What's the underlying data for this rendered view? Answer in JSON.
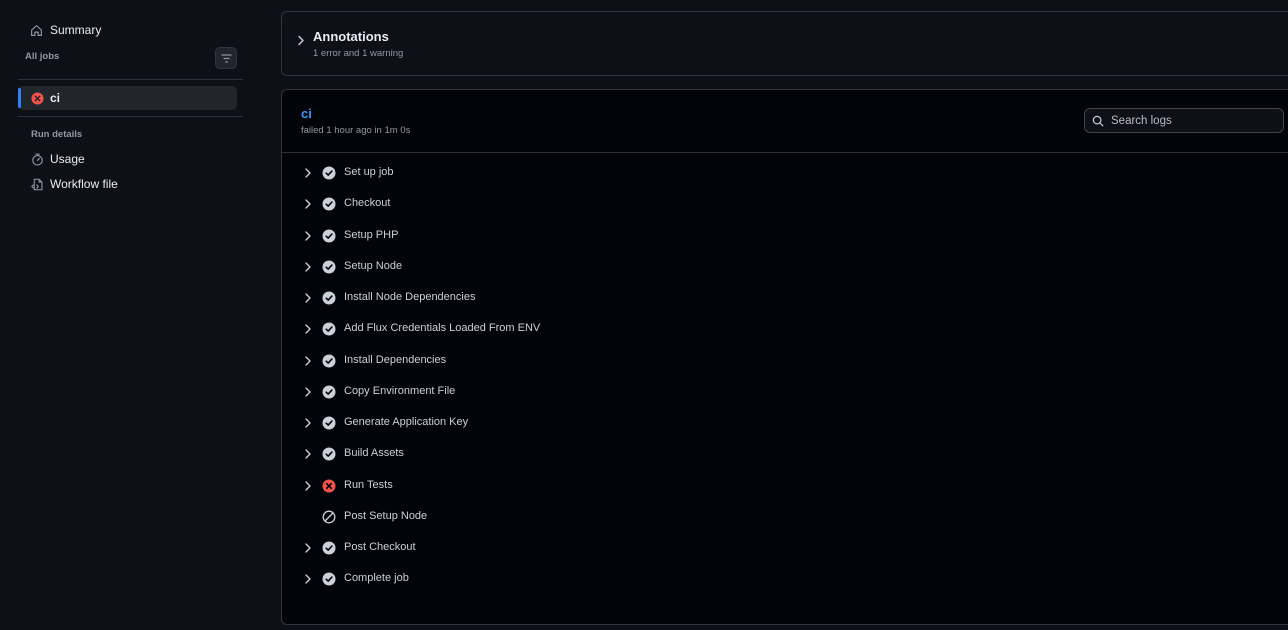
{
  "sidebar": {
    "summary_label": "Summary",
    "all_jobs_label": "All jobs",
    "jobs": [
      {
        "label": "ci",
        "status": "failure"
      }
    ],
    "run_details_label": "Run details",
    "links": [
      {
        "label": "Usage",
        "icon": "stopwatch-icon"
      },
      {
        "label": "Workflow file",
        "icon": "workflow-file-icon"
      }
    ]
  },
  "annotations": {
    "title": "Annotations",
    "subtitle": "1 error and 1 warning"
  },
  "job": {
    "title": "ci",
    "meta": "failed 1 hour ago in 1m 0s",
    "search_placeholder": "Search logs",
    "steps": [
      {
        "label": "Set up job",
        "status": "success",
        "expandable": true
      },
      {
        "label": "Checkout",
        "status": "success",
        "expandable": true
      },
      {
        "label": "Setup PHP",
        "status": "success",
        "expandable": true
      },
      {
        "label": "Setup Node",
        "status": "success",
        "expandable": true
      },
      {
        "label": "Install Node Dependencies",
        "status": "success",
        "expandable": true
      },
      {
        "label": "Add Flux Credentials Loaded From ENV",
        "status": "success",
        "expandable": true
      },
      {
        "label": "Install Dependencies",
        "status": "success",
        "expandable": true
      },
      {
        "label": "Copy Environment File",
        "status": "success",
        "expandable": true
      },
      {
        "label": "Generate Application Key",
        "status": "success",
        "expandable": true
      },
      {
        "label": "Build Assets",
        "status": "success",
        "expandable": true
      },
      {
        "label": "Run Tests",
        "status": "failure",
        "expandable": true
      },
      {
        "label": "Post Setup Node",
        "status": "skipped",
        "expandable": false
      },
      {
        "label": "Post Checkout",
        "status": "success",
        "expandable": true
      },
      {
        "label": "Complete job",
        "status": "success",
        "expandable": true
      }
    ]
  },
  "colors": {
    "background": "#0d1117",
    "panel": "#010409",
    "accent": "#2f81f7",
    "link": "#4493f8",
    "failure": "#f85149",
    "success_icon": "#c9d1d9",
    "muted_text": "#9198a1"
  }
}
